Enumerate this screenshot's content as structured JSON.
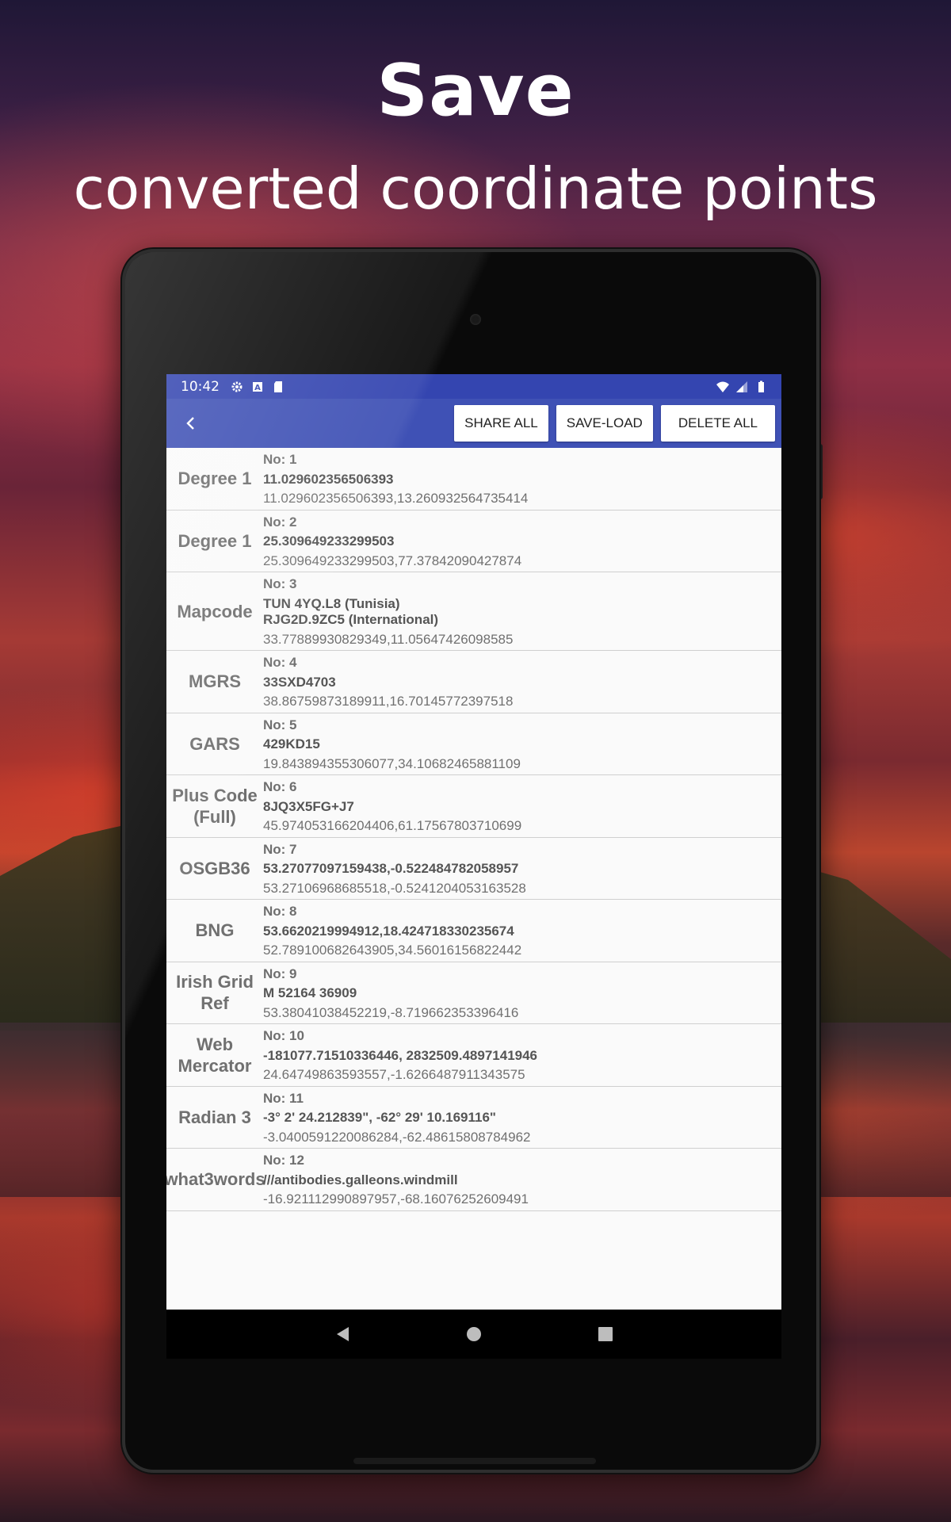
{
  "headline": {
    "title": "Save",
    "subtitle": "converted coordinate points"
  },
  "statusbar": {
    "time": "10:42",
    "icons_left": [
      "settings-icon",
      "font-icon",
      "sd-card-icon"
    ],
    "icons_right": [
      "wifi-icon",
      "signal-icon",
      "battery-icon"
    ]
  },
  "toolbar": {
    "back_icon": "chevron-left-icon",
    "share_all_label": "SHARE ALL",
    "save_load_label": "SAVE-LOAD",
    "delete_all_label": "DELETE ALL",
    "color": "#3f51b5"
  },
  "entries": [
    {
      "label": "Degree 1",
      "no": "No: 1",
      "main": "11.029602356506393",
      "coords": "11.029602356506393,13.260932564735414"
    },
    {
      "label": "Degree 1",
      "no": "No: 2",
      "main": "25.309649233299503",
      "coords": "25.309649233299503,77.37842090427874"
    },
    {
      "label": "Mapcode",
      "no": "No: 3",
      "main": "TUN 4YQ.L8 (Tunisia)",
      "main2": "RJG2D.9ZC5 (International)",
      "coords": "33.77889930829349,11.05647426098585"
    },
    {
      "label": "MGRS",
      "no": "No: 4",
      "main": "33SXD4703",
      "coords": "38.86759873189911,16.70145772397518"
    },
    {
      "label": "GARS",
      "no": "No: 5",
      "main": "429KD15",
      "coords": "19.843894355306077,34.10682465881109"
    },
    {
      "label": "Plus Code (Full)",
      "no": "No: 6",
      "main": "8JQ3X5FG+J7",
      "coords": "45.974053166204406,61.17567803710699"
    },
    {
      "label": "OSGB36",
      "no": "No: 7",
      "main": "53.27077097159438,-0.522484782058957",
      "coords": "53.27106968685518,-0.5241204053163528"
    },
    {
      "label": "BNG",
      "no": "No: 8",
      "main": "53.6620219994912,18.424718330235674",
      "coords": "52.789100682643905,34.56016156822442"
    },
    {
      "label": "Irish Grid Ref",
      "no": "No: 9",
      "main": "M 52164 36909",
      "coords": "53.38041038452219,-8.719662353396416"
    },
    {
      "label": "Web Mercator",
      "no": "No: 10",
      "main": "-181077.71510336446, 2832509.4897141946",
      "coords": "24.64749863593557,-1.6266487911343575"
    },
    {
      "label": "Radian 3",
      "no": "No: 11",
      "main": "-3° 2' 24.212839\", -62° 29' 10.169116\"",
      "coords": "-3.0400591220086284,-62.48615808784962"
    },
    {
      "label": "what3words",
      "no": "No: 12",
      "main": "///antibodies.galleons.windmill",
      "coords": "-16.921112990897957,-68.16076252609491"
    }
  ],
  "navbar": {
    "back": "nav-back-icon",
    "home": "nav-home-icon",
    "recents": "nav-recents-icon"
  }
}
